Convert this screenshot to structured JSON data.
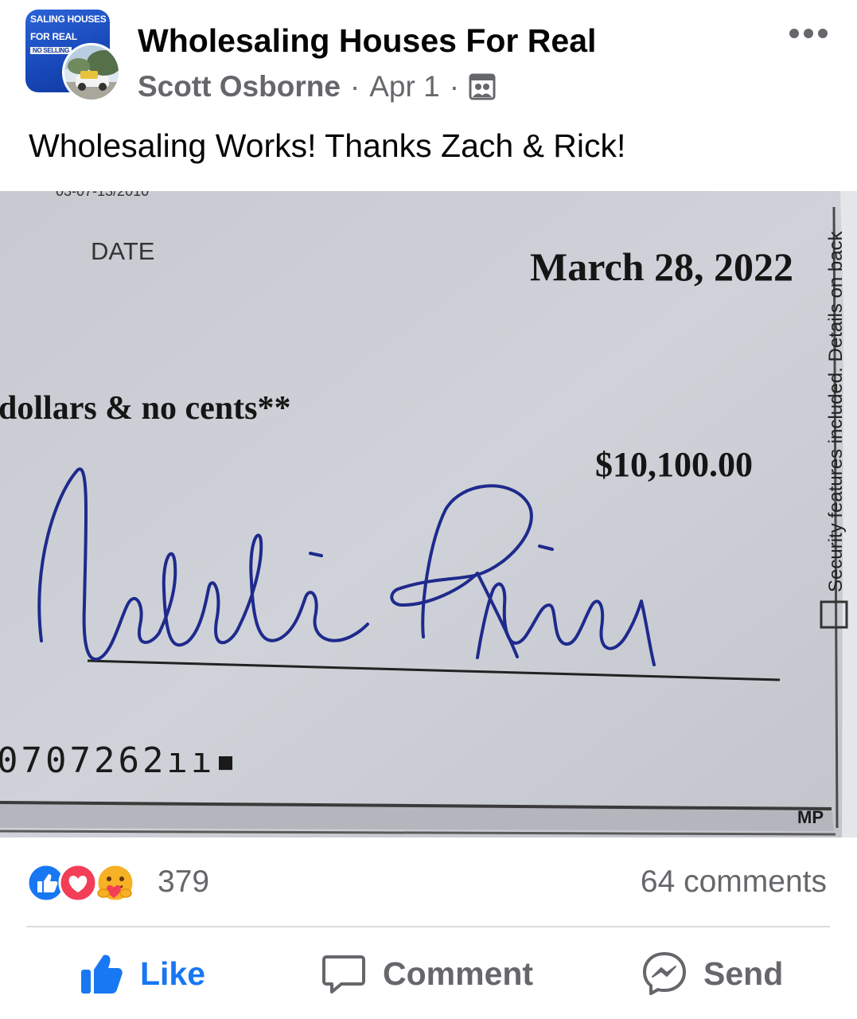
{
  "post": {
    "group_avatar_lines": [
      "SALING HOUSES",
      "FOR REAL",
      "NO SELLING"
    ],
    "group_name": "Wholesaling Houses For Real",
    "author": "Scott Osborne",
    "date": "Apr 1",
    "separator": "·",
    "privacy_icon": "group-audience-icon",
    "more_icon": "more-horizontal-icon",
    "text": "Wholesaling Works! Thanks Zach & Rick!"
  },
  "check": {
    "top_partial": "03-07-13/2010",
    "date_label": "DATE",
    "date_value": "March 28, 2022",
    "written_amount": "dollars & no cents**",
    "amount": "$10,100.00",
    "security_text": "Security features included. Details on back",
    "micr": "0707262ıı▪",
    "printer_mark": "MP"
  },
  "reactions": {
    "icons": [
      "like-reaction-icon",
      "love-reaction-icon",
      "care-reaction-icon"
    ],
    "count": "379",
    "comments": "64 comments"
  },
  "actions": {
    "like": "Like",
    "comment": "Comment",
    "send": "Send"
  },
  "colors": {
    "facebook_blue": "#1877f2",
    "secondary_text": "#65676b",
    "love_red": "#f33e58",
    "care_yellow": "#f7b125"
  }
}
